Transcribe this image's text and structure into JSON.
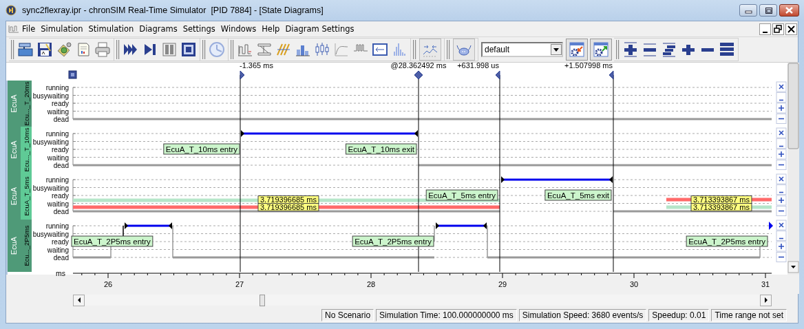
{
  "window": {
    "title": "sync2flexray.ipr - chronSIM Real-Time Simulator  [PID 7884] - [State Diagrams]"
  },
  "menu": [
    {
      "label": "File"
    },
    {
      "label": "Simulation"
    },
    {
      "label": "Stimulation"
    },
    {
      "label": "Diagrams"
    },
    {
      "label": "Settings"
    },
    {
      "label": "Windows"
    },
    {
      "label": "Help"
    },
    {
      "label": "Diagram Settings"
    }
  ],
  "toolbar": {
    "profile_combo": {
      "value": "default"
    }
  },
  "cursors": [
    {
      "label": "-1.365 ms",
      "kind": "offset"
    },
    {
      "label": "@28.362492 ms",
      "kind": "reference"
    },
    {
      "label": "+631.998 us",
      "kind": "offset"
    },
    {
      "label": "+1.507998 ms",
      "kind": "offset"
    }
  ],
  "rows": [
    {
      "group": "EcuA",
      "task": "Ecu..._T_20ms",
      "selected": false,
      "states": [
        "running",
        "busywaiting",
        "ready",
        "waiting",
        "dead"
      ],
      "events": [],
      "measurements": []
    },
    {
      "group": "EcuA",
      "task": "Ecu..._T_10ms",
      "selected": true,
      "states": [
        "running",
        "busywaiting",
        "ready",
        "waiting",
        "dead"
      ],
      "events": [
        "EcuA_T_10ms entry",
        "EcuA_T_10ms exit"
      ],
      "measurements": []
    },
    {
      "group": "EcuA",
      "task": "EcuA_T_5ms",
      "selected": true,
      "states": [
        "running",
        "busywaiting",
        "ready",
        "waiting",
        "dead"
      ],
      "events": [
        "EcuA_T_5ms entry",
        "EcuA_T_5ms exit"
      ],
      "measurements": [
        "3.719396685 ms",
        "3.719396685 ms",
        "3.713393867 ms",
        "3.713393867 ms"
      ]
    },
    {
      "group": "EcuA",
      "task": "Ecu..._2P5ms",
      "selected": false,
      "states": [
        "running",
        "busywaiting",
        "ready",
        "waiting",
        "dead"
      ],
      "events": [
        "EcuA_T_2P5ms entry",
        "EcuA_T_2P5ms entry",
        "EcuA_T_2P5ms entry"
      ],
      "measurements": []
    }
  ],
  "axis": {
    "unit": "ms",
    "ticks": [
      "26",
      "27",
      "28",
      "29",
      "30",
      "31"
    ]
  },
  "status_bar": [
    "No Scenario",
    "Simulation Time: 100.000000000 ms",
    "Simulation Speed: 3680 events/s",
    "Speedup: 0.01",
    "Time range not set"
  ]
}
